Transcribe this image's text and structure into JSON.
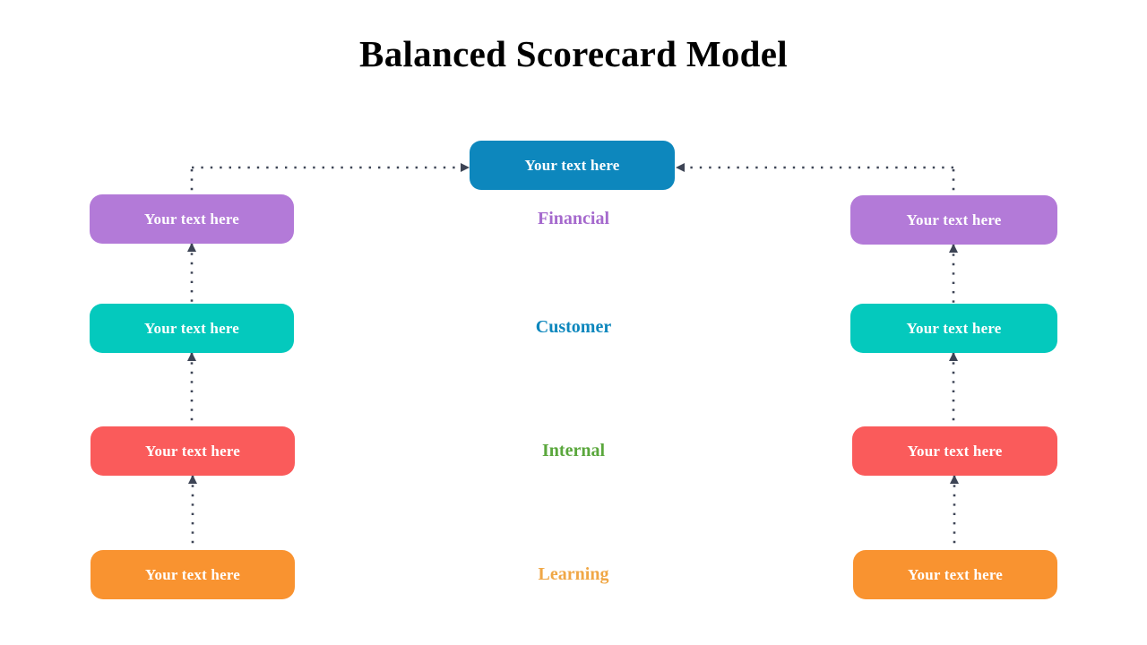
{
  "page": {
    "title": "Balanced Scorecard Model",
    "background": "#ffffff",
    "title_color": "#000000"
  },
  "palette": {
    "top_blue": "#0d87bd",
    "purple": "#b37ad8",
    "teal": "#04c9bd",
    "coral": "#fa5b5b",
    "orange": "#f99330",
    "financial_label": "#a569cd",
    "customer_label": "#0d87bd",
    "internal_label": "#5aa73c",
    "learning_label": "#f0a746",
    "connector": "#3d4455",
    "card_text": "#ffffff"
  },
  "top_node": {
    "label": "Your text here",
    "color": "#0d87bd"
  },
  "perspectives": [
    {
      "name": "Financial",
      "color": "#a569cd"
    },
    {
      "name": "Customer",
      "color": "#0d87bd"
    },
    {
      "name": "Internal",
      "color": "#5aa73c"
    },
    {
      "name": "Learning",
      "color": "#f0a746"
    }
  ],
  "left_column": [
    {
      "label": "Your text here",
      "color": "#b37ad8",
      "perspective": "Financial"
    },
    {
      "label": "Your text here",
      "color": "#04c9bd",
      "perspective": "Customer"
    },
    {
      "label": "Your text here",
      "color": "#fa5b5b",
      "perspective": "Internal"
    },
    {
      "label": "Your text here",
      "color": "#f99330",
      "perspective": "Learning"
    }
  ],
  "right_column": [
    {
      "label": "Your text here",
      "color": "#b37ad8",
      "perspective": "Financial"
    },
    {
      "label": "Your text here",
      "color": "#04c9bd",
      "perspective": "Customer"
    },
    {
      "label": "Your text here",
      "color": "#fa5b5b",
      "perspective": "Internal"
    },
    {
      "label": "Your text here",
      "color": "#f99330",
      "perspective": "Learning"
    }
  ],
  "connectors": {
    "style": "dotted",
    "color": "#3d4455",
    "arrow_direction": "upward-and-inward"
  }
}
